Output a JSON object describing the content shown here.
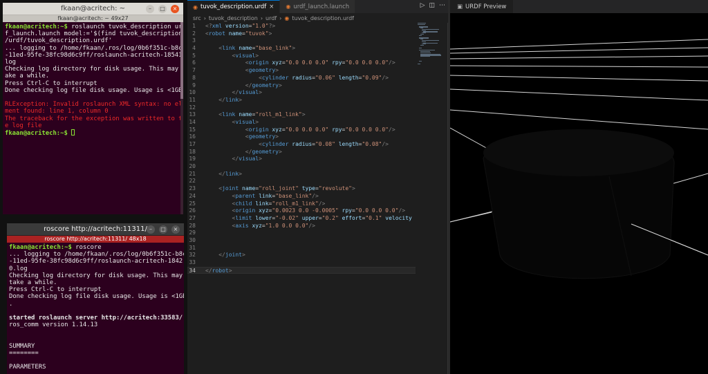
{
  "terminal1": {
    "title": "fkaan@acritech: ~",
    "tab": "fkaan@acritech: ~ 49x27",
    "lines": [
      {
        "type": "prompt",
        "prompt": "fkaan@acritech:~$",
        "text": " roslaunch tuvok_description urd"
      },
      {
        "type": "out",
        "text": "f_launch.launch model:='$(find tuvok_description)"
      },
      {
        "type": "out",
        "text": "/urdf/tuvok_description.urdf'"
      },
      {
        "type": "out",
        "text": "... logging to /home/fkaan/.ros/log/0b6f351c-b8cd"
      },
      {
        "type": "out",
        "text": "-11ed-95fe-38fc98d6c9ff/roslaunch-acritech-18541."
      },
      {
        "type": "out",
        "text": "log"
      },
      {
        "type": "out",
        "text": "Checking log directory for disk usage. This may t"
      },
      {
        "type": "out",
        "text": "ake a while."
      },
      {
        "type": "out",
        "text": "Press Ctrl-C to interrupt"
      },
      {
        "type": "out",
        "text": "Done checking log file disk usage. Usage is <1GB."
      },
      {
        "type": "out",
        "text": ""
      },
      {
        "type": "err",
        "text": "RLException: Invalid roslaunch XML syntax: no ele"
      },
      {
        "type": "err",
        "text": "ment found: line 1, column 0"
      },
      {
        "type": "err",
        "text": "The traceback for the exception was written to th"
      },
      {
        "type": "err",
        "text": "e log file"
      },
      {
        "type": "prompt-cursor",
        "prompt": "fkaan@acritech:~$",
        "text": " "
      }
    ]
  },
  "terminal2": {
    "title": "roscore http://acritech:11311/",
    "tab": "roscore http://acritech:11311/ 48x18",
    "lines": [
      {
        "type": "prompt",
        "prompt": "fkaan@acritech:~$",
        "text": " roscore"
      },
      {
        "type": "out",
        "text": "... logging to /home/fkaan/.ros/log/0b6f351c-b8cd"
      },
      {
        "type": "out",
        "text": "-11ed-95fe-38fc98d6c9ff/roslaunch-acritech-1842"
      },
      {
        "type": "out",
        "text": "0.log"
      },
      {
        "type": "out",
        "text": "Checking log directory for disk usage. This may"
      },
      {
        "type": "out",
        "text": "take a while."
      },
      {
        "type": "out",
        "text": "Press Ctrl-C to interrupt"
      },
      {
        "type": "out",
        "text": "Done checking log file disk usage. Usage is <1GB"
      },
      {
        "type": "out",
        "text": "."
      },
      {
        "type": "out",
        "text": ""
      },
      {
        "type": "bold",
        "text": "started roslaunch server http://acritech:33583/"
      },
      {
        "type": "out",
        "text": "ros_comm version 1.14.13"
      },
      {
        "type": "out",
        "text": ""
      },
      {
        "type": "out",
        "text": ""
      },
      {
        "type": "out",
        "text": "SUMMARY"
      },
      {
        "type": "out",
        "text": "========"
      },
      {
        "type": "out",
        "text": ""
      },
      {
        "type": "out",
        "text": "PARAMETERS"
      }
    ]
  },
  "editor": {
    "tabs": [
      {
        "label": "tuvok_description.urdf",
        "active": true
      },
      {
        "label": "urdf_launch.launch",
        "active": false
      }
    ],
    "breadcrumb": [
      "src",
      "tuvok_description",
      "urdf",
      "tuvok_description.urdf"
    ],
    "current_line": 34,
    "lines": [
      "<?xml version=\"1.0\"?>",
      "<robot name=\"tuvok\">",
      "",
      "    <link name=\"base_link\">",
      "        <visual>",
      "            <origin xyz=\"0.0 0.0 0.0\" rpy=\"0.0 0.0 0.0\"/>",
      "            <geometry>",
      "                <cylinder radius=\"0.06\" length=\"0.09\"/>",
      "            </geometry>",
      "        </visual>",
      "    </link>",
      "",
      "    <link name=\"roll_m1_link\">",
      "        <visual>",
      "            <origin xyz=\"0.0 0.0 0.0\" rpy=\"0.0 0.0 0.0\"/>",
      "            <geometry>",
      "                <cylinder radius=\"0.08\" length=\"0.08\"/>",
      "            </geometry>",
      "        </visual>",
      "",
      "    </link>",
      "",
      "    <joint name=\"roll_joint\" type=\"revolute\">",
      "        <parent link=\"base_link\"/>",
      "        <child link=\"roll_m1_link\"/>",
      "        <origin xyz=\"0.0023 0.0 -0.0005\" rpy=\"0.0 0.0 0.0\"/>",
      "        <limit lower=\"-0.02\" upper=\"0.2\" effort=\"0.1\" velocity",
      "        <axis xyz=\"1.0 0.0 0.0\"/>",
      "",
      "",
      "",
      "    </joint>",
      "",
      "</robot>"
    ]
  },
  "preview": {
    "tab_label": "URDF Preview"
  },
  "icons": {
    "run": "play-icon",
    "split": "split-editor-icon",
    "more": "more-icon",
    "file": "rss-file-icon",
    "preview": "preview-icon"
  }
}
